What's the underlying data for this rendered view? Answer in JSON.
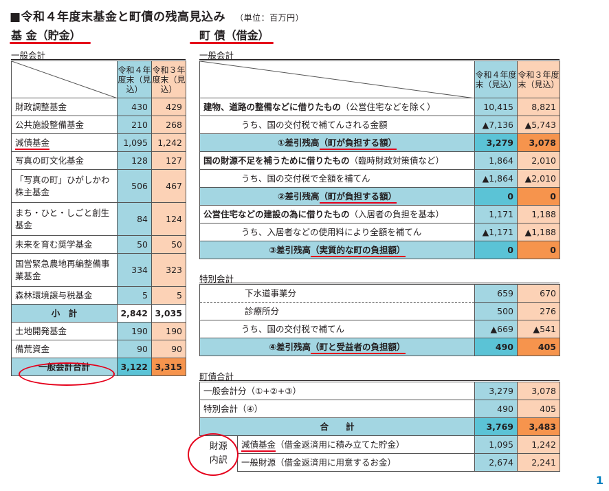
{
  "title": "■令和４年度末基金と町債の残高見込み",
  "unit": "（単位：百万円）",
  "page_number": "1",
  "colors": {
    "r4_light": "#a3d6e2",
    "r3_light": "#fcd2b6",
    "r4_strong": "#5bc3d6",
    "r3_strong": "#f6944d",
    "mark_red": "#e5001b"
  },
  "left": {
    "heading": "基 金（貯金）",
    "section": "一般会計",
    "col_r4": "令和４年度末（見込）",
    "col_r3": "令和３年度末（見込）",
    "rows": [
      {
        "label": "財政調整基金",
        "r4": "430",
        "r3": "429"
      },
      {
        "label": "公共施設整備基金",
        "r4": "210",
        "r3": "268"
      },
      {
        "label": "減債基金",
        "r4": "1,095",
        "r3": "1,242"
      },
      {
        "label": "写真の町文化基金",
        "r4": "128",
        "r3": "127"
      },
      {
        "label": "「写真の町」ひがしかわ株主基金",
        "r4": "506",
        "r3": "467"
      },
      {
        "label": "まち・ひと・しごと創生基金",
        "r4": "84",
        "r3": "124"
      },
      {
        "label": "未来を育む奨学基金",
        "r4": "50",
        "r3": "50"
      },
      {
        "label": "国営緊急農地再編整備事業基金",
        "r4": "334",
        "r3": "323"
      },
      {
        "label": "森林環境譲与税基金",
        "r4": "5",
        "r3": "5"
      }
    ],
    "subtotal": {
      "label": "小　計",
      "r4": "2,842",
      "r3": "3,035"
    },
    "rows2": [
      {
        "label": "土地開発基金",
        "r4": "190",
        "r3": "190"
      },
      {
        "label": "備荒資金",
        "r4": "90",
        "r3": "90"
      }
    ],
    "total": {
      "label": "一般会計合計",
      "r4": "3,122",
      "r3": "3,315"
    }
  },
  "right": {
    "heading": "町 債（借金）",
    "general": {
      "section": "一般会計",
      "col_r4": "令和４年度末（見込）",
      "col_r3": "令和３年度末（見込）",
      "rows": [
        {
          "label": "建物、道路の整備などに借りたもの",
          "note": "（公営住宅などを除く）",
          "r4": "10,415",
          "r3": "8,821",
          "kind": "main"
        },
        {
          "label": "うち、国の交付税で補てんされる金額",
          "r4": "▲7,136",
          "r3": "▲5,743",
          "kind": "sub"
        },
        {
          "label": "①差引残高",
          "note": "（町が負担する額）",
          "r4": "3,279",
          "r3": "3,078",
          "kind": "balance"
        },
        {
          "label": "国の財源不足を補うために借りたもの",
          "note": "（臨時財政対策債など）",
          "r4": "1,864",
          "r3": "2,010",
          "kind": "main"
        },
        {
          "label": "うち、国の交付税で全額を補てん",
          "r4": "▲1,864",
          "r3": "▲2,010",
          "kind": "sub"
        },
        {
          "label": "②差引残高",
          "note": "（町が負担する額）",
          "r4": "0",
          "r3": "0",
          "kind": "balance"
        },
        {
          "label": "公営住宅などの建設の為に借りたもの",
          "note": "（入居者の負担を基本）",
          "r4": "1,171",
          "r3": "1,188",
          "kind": "main"
        },
        {
          "label": "うち、入居者などの使用料により全額を補てん",
          "r4": "▲1,171",
          "r3": "▲1,188",
          "kind": "sub"
        },
        {
          "label": "③差引残高",
          "note": "（実質的な町の負担額）",
          "r4": "0",
          "r3": "0",
          "kind": "balance"
        }
      ]
    },
    "special": {
      "section": "特別会計",
      "rows": [
        {
          "label": "下水道事業分",
          "r4": "659",
          "r3": "670"
        },
        {
          "label": "診療所分",
          "r4": "500",
          "r3": "276"
        },
        {
          "label": "うち、国の交付税で補てん",
          "r4": "▲669",
          "r3": "▲541"
        }
      ],
      "balance": {
        "label": "④差引残高",
        "note": "（町と受益者の負担額）",
        "r4": "490",
        "r3": "405"
      }
    },
    "total": {
      "section": "町債合計",
      "rows": [
        {
          "label": "一般会計分（①+②+③）",
          "r4": "3,279",
          "r3": "3,078"
        },
        {
          "label": "特別会計（④）",
          "r4": "490",
          "r3": "405"
        }
      ],
      "sum": {
        "label": "合　　計",
        "r4": "3,769",
        "r3": "3,483"
      },
      "breakdown_label": "財源内訳",
      "breakdown": [
        {
          "label": "減債基金",
          "note": "（借金返済用に積み立てた貯金）",
          "r4": "1,095",
          "r3": "1,242"
        },
        {
          "label": "一般財源",
          "note": "（借金返済用に用意するお金）",
          "r4": "2,674",
          "r3": "2,241"
        }
      ]
    }
  }
}
